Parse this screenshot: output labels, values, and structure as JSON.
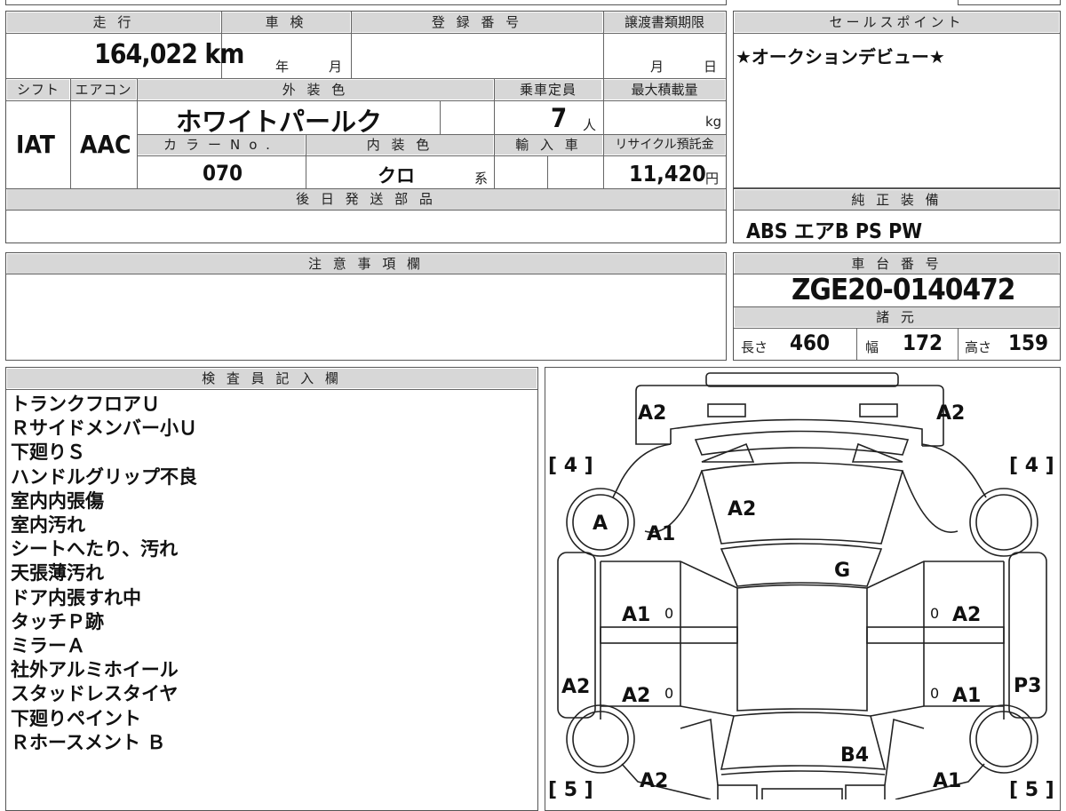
{
  "header": {
    "mileage_label": "走 行",
    "inspection_label": "車 検",
    "registration_label": "登 録 番 号",
    "transfer_label": "譲渡書類期限",
    "sales_points_label": "セールスポイント"
  },
  "mileage": "164,022 km",
  "inspection": {
    "year": "年",
    "month": "月"
  },
  "transfer": {
    "month": "月",
    "day": "日"
  },
  "row2_labels": {
    "shift": "シフト",
    "aircon": "エアコン",
    "exterior_color": "外 装 色",
    "capacity": "乗車定員",
    "max_load": "最大積載量",
    "color_no": "カラーNo.",
    "interior_color": "内 装 色",
    "import": "輸 入 車",
    "recycle": "リサイクル預託金",
    "later_parts": "後 日 発 送 部 品",
    "equipment": "純 正 装 備",
    "caution": "注 意 事 項 欄",
    "chassis": "車 台 番 号",
    "specs": "諸 元",
    "inspector": "検 査 員 記 入 欄"
  },
  "shift": "IAT",
  "aircon": "AAC",
  "exterior_color": "ホワイトパールク",
  "capacity": {
    "value": "7",
    "unit": "人"
  },
  "max_load": {
    "unit": "kg"
  },
  "color_no": "070",
  "interior_color": {
    "value": "クロ",
    "unit": "系"
  },
  "recycle": {
    "value": "11,420",
    "unit": "円"
  },
  "sales_point": "★オークションデビュー★",
  "equipment": "ABS エアB PS PW",
  "chassis_number": "ZGE20-0140472",
  "specs": {
    "length_label": "長さ",
    "length": "460",
    "width_label": "幅",
    "width": "172",
    "height_label": "高さ",
    "height": "159"
  },
  "inspector_notes": [
    "トランクフロアＵ",
    "Ｒサイドメンバー小Ｕ",
    "下廻りＳ",
    "ハンドルグリップ不良",
    "室内内張傷",
    "室内汚れ",
    "シートへたり、汚れ",
    "天張薄汚れ",
    "ドア内張すれ中",
    "タッチＰ跡",
    "ミラーＡ",
    "社外アルミホイール",
    "スタッドレスタイヤ",
    "下廻りペイント",
    "Ｒホースメント Ｂ"
  ],
  "diagram": {
    "tread_rear_left": "[ 4 ]",
    "tread_rear_right": "[ 4 ]",
    "tread_front_left": "[ 5 ]",
    "tread_front_right": "[ 5 ]",
    "rear_left_corner": "A2",
    "rear_right_corner": "A2",
    "rear_glass": "A2",
    "rear_left_wheel": "A",
    "rear_left_quarter": "A1",
    "roof": "G",
    "left_rear_door": "A1",
    "left_rear_door_mark": "0",
    "right_rear_door": "A2",
    "right_rear_door_mark": "0",
    "left_sill": "A2",
    "left_front_door": "A2",
    "left_front_door_mark": "0",
    "right_front_door": "A1",
    "right_front_door_mark": "0",
    "right_sill": "P3",
    "bonnet": "B4",
    "front_left_fender": "A2",
    "front_right_fender": "A1"
  }
}
